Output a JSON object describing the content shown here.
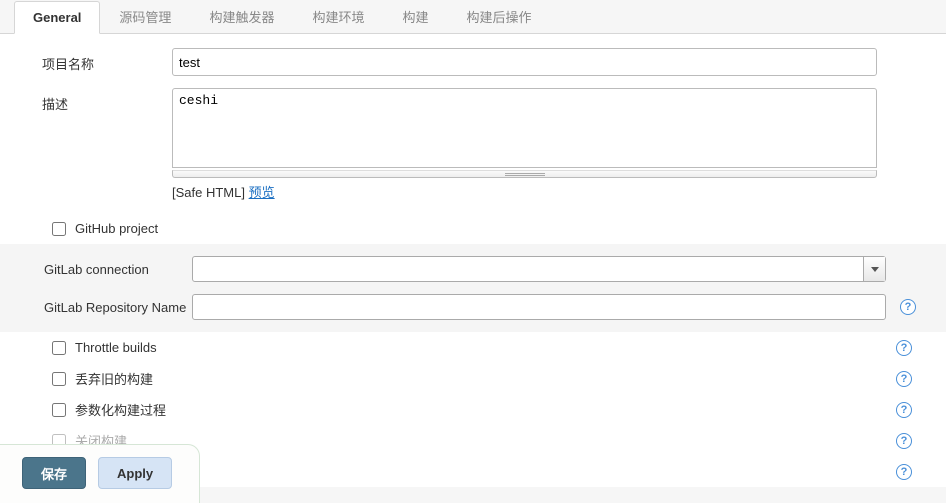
{
  "tabs": [
    {
      "id": "general",
      "label": "General",
      "active": true
    },
    {
      "id": "scm",
      "label": "源码管理"
    },
    {
      "id": "triggers",
      "label": "构建触发器"
    },
    {
      "id": "env",
      "label": "构建环境"
    },
    {
      "id": "build",
      "label": "构建"
    },
    {
      "id": "post",
      "label": "构建后操作"
    }
  ],
  "fields": {
    "project_name_label": "项目名称",
    "project_name_value": "test",
    "description_label": "描述",
    "description_value": "ceshi",
    "safe_html": "[Safe HTML]",
    "preview": "预览"
  },
  "gitlab": {
    "connection_label": "GitLab connection",
    "connection_value": "",
    "repo_label": "GitLab Repository Name",
    "repo_value": ""
  },
  "options": {
    "github_project": "GitHub project",
    "throttle_builds": "Throttle builds",
    "discard_old": "丢弃旧的构建",
    "parameterized": "参数化构建过程",
    "close_build": "关闭构建"
  },
  "buttons": {
    "save": "保存",
    "apply": "Apply"
  },
  "icons": {
    "help_glyph": "?"
  }
}
